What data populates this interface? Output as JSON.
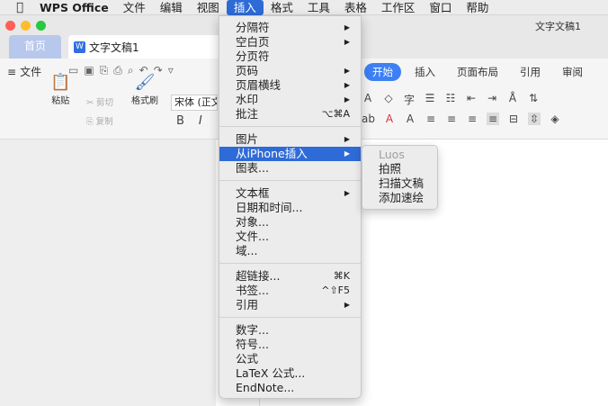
{
  "menubar": {
    "apple": "",
    "app_name": "WPS Office",
    "items": [
      "文件",
      "编辑",
      "视图",
      "插入",
      "格式",
      "工具",
      "表格",
      "工作区",
      "窗口",
      "帮助"
    ]
  },
  "window": {
    "title": "文字文稿1",
    "home_tab": "首页",
    "doc_tab": "文字文稿1",
    "doc_tab_icon": "W"
  },
  "ribbon": {
    "file_menu": "文件",
    "tabs": [
      "开始",
      "插入",
      "页面布局",
      "引用",
      "审阅"
    ],
    "active_tab": "开始",
    "paste": "粘贴",
    "cut": "剪切",
    "copy": "复制",
    "format_painter": "格式刷",
    "font_name": "宋体 (正文",
    "bold": "B",
    "italic": "I"
  },
  "insert_menu": {
    "items": [
      {
        "label": "分隔符",
        "shortcut": "",
        "submenu": true
      },
      {
        "label": "空白页",
        "shortcut": "",
        "submenu": true
      },
      {
        "label": "分页符",
        "shortcut": "",
        "submenu": false
      },
      {
        "label": "页码",
        "shortcut": "",
        "submenu": true
      },
      {
        "label": "页眉横线",
        "shortcut": "",
        "submenu": true
      },
      {
        "label": "水印",
        "shortcut": "",
        "submenu": true
      },
      {
        "label": "批注",
        "shortcut": "⌥⌘A",
        "submenu": false
      },
      {
        "label": "图片",
        "shortcut": "",
        "submenu": true
      },
      {
        "label": "从iPhone插入",
        "shortcut": "",
        "submenu": true,
        "highlighted": true
      },
      {
        "label": "图表...",
        "shortcut": "",
        "submenu": false
      },
      {
        "label": "文本框",
        "shortcut": "",
        "submenu": true
      },
      {
        "label": "日期和时间...",
        "shortcut": "",
        "submenu": false
      },
      {
        "label": "对象...",
        "shortcut": "",
        "submenu": false
      },
      {
        "label": "文件...",
        "shortcut": "",
        "submenu": false
      },
      {
        "label": "域...",
        "shortcut": "",
        "submenu": false
      },
      {
        "label": "超链接...",
        "shortcut": "⌘K",
        "submenu": false
      },
      {
        "label": "书签...",
        "shortcut": "^⇧F5",
        "submenu": false
      },
      {
        "label": "引用",
        "shortcut": "",
        "submenu": true
      },
      {
        "label": "数字...",
        "shortcut": "",
        "submenu": false
      },
      {
        "label": "符号...",
        "shortcut": "",
        "submenu": false
      },
      {
        "label": "公式",
        "shortcut": "",
        "submenu": false
      },
      {
        "label": "LaTeX 公式...",
        "shortcut": "",
        "submenu": false
      },
      {
        "label": "EndNote...",
        "shortcut": "",
        "submenu": false
      }
    ],
    "arrow_glyph": "▶"
  },
  "iphone_submenu": {
    "items": [
      {
        "label": "Luos",
        "disabled": true
      },
      {
        "label": "拍照",
        "disabled": false
      },
      {
        "label": "扫描文稿",
        "disabled": false
      },
      {
        "label": "添加速绘",
        "disabled": false
      }
    ]
  },
  "colors": {
    "accent": "#2e6bd6",
    "ribbon_active_tab": "#3d7ff5",
    "home_tab": "#b8c7ec"
  }
}
